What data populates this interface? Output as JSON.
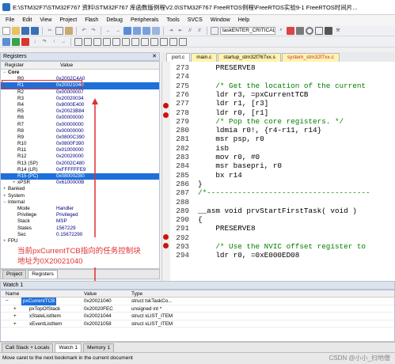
{
  "titlebar": {
    "title": "E:\\STM32F7\\STM32F767 资料\\STM32F767 库函数版例程V2.0\\STM32F767 FreeRTOS例程\\FreeRTOS实验9-1 FreeRTOS时间片..."
  },
  "menu": [
    "File",
    "Edit",
    "View",
    "Project",
    "Flash",
    "Debug",
    "Peripherals",
    "Tools",
    "SVCS",
    "Window",
    "Help"
  ],
  "toolbar": {
    "function_combo": "taskENTER_CRITICAL()"
  },
  "registers": {
    "title": "Registers",
    "col_register": "Register",
    "col_value": "Value",
    "rows": [
      {
        "exp": "−",
        "name": "Core",
        "value": "",
        "indent": 0,
        "bold": true
      },
      {
        "exp": "",
        "name": "R0",
        "value": "0x2002C4A0",
        "indent": 2
      },
      {
        "exp": "",
        "name": "R1",
        "value": "0x20021040",
        "indent": 2,
        "selected": true
      },
      {
        "exp": "",
        "name": "R2",
        "value": "0x00000007",
        "indent": 2
      },
      {
        "exp": "",
        "name": "R3",
        "value": "0x20020034",
        "indent": 2
      },
      {
        "exp": "",
        "name": "R4",
        "value": "0x8000E400",
        "indent": 2
      },
      {
        "exp": "",
        "name": "R5",
        "value": "0x20023B84",
        "indent": 2
      },
      {
        "exp": "",
        "name": "R6",
        "value": "0x00000000",
        "indent": 2
      },
      {
        "exp": "",
        "name": "R7",
        "value": "0x00000000",
        "indent": 2
      },
      {
        "exp": "",
        "name": "R8",
        "value": "0x00000000",
        "indent": 2
      },
      {
        "exp": "",
        "name": "R9",
        "value": "0x0800C390",
        "indent": 2
      },
      {
        "exp": "",
        "name": "R10",
        "value": "0x0800F390",
        "indent": 2
      },
      {
        "exp": "",
        "name": "R11",
        "value": "0x01000000",
        "indent": 2
      },
      {
        "exp": "",
        "name": "R12",
        "value": "0x20020000",
        "indent": 2
      },
      {
        "exp": "",
        "name": "R13 (SP)",
        "value": "0x2002C480",
        "indent": 2
      },
      {
        "exp": "",
        "name": "R14 (LR)",
        "value": "0xFFFFFFE9",
        "indent": 2
      },
      {
        "exp": "",
        "name": "R15 (PC)",
        "value": "0x08000ZB0",
        "indent": 2,
        "selected": true
      },
      {
        "exp": "+",
        "name": "xPSR",
        "value": "0x6100000B",
        "indent": 2
      },
      {
        "exp": "+",
        "name": "Banked",
        "value": "",
        "indent": 0
      },
      {
        "exp": "+",
        "name": "System",
        "value": "",
        "indent": 0
      },
      {
        "exp": "−",
        "name": "Internal",
        "value": "",
        "indent": 0
      },
      {
        "exp": "",
        "name": "Mode",
        "value": "Handler",
        "indent": 2
      },
      {
        "exp": "",
        "name": "Privilege",
        "value": "Privileged",
        "indent": 2
      },
      {
        "exp": "",
        "name": "Stack",
        "value": "MSP",
        "indent": 2
      },
      {
        "exp": "",
        "name": "States",
        "value": "1567229",
        "indent": 2
      },
      {
        "exp": "",
        "name": "Sec",
        "value": "0.15672290",
        "indent": 2
      },
      {
        "exp": "+",
        "name": "FPU",
        "value": "",
        "indent": 0
      }
    ],
    "tabs": [
      "Project",
      "Registers"
    ]
  },
  "annotation": {
    "text": "当前pxCurrentTCB指向的任务控制块地址为0X20021040"
  },
  "editor": {
    "tabs": [
      {
        "label": "port.c",
        "active": true
      },
      {
        "label": "main.c"
      },
      {
        "label": "startup_stm32f767xx.s"
      },
      {
        "label": "system_stm32f7xx.c"
      }
    ],
    "lines": [
      {
        "n": "273",
        "text": "    PRESERVE8",
        "cls": ""
      },
      {
        "n": "274",
        "text": "",
        "cls": ""
      },
      {
        "n": "275",
        "text": "    /* Get the location of the current",
        "cls": "cm"
      },
      {
        "n": "276",
        "text": "    ldr r3, =pxCurrentTCB",
        "cls": ""
      },
      {
        "n": "277",
        "text": "    ldr r1, [r3]",
        "cls": ""
      },
      {
        "n": "278",
        "text": "    ldr r0, [r1]",
        "cls": ""
      },
      {
        "n": "279",
        "text": "    /* Pop the core registers. */",
        "cls": "cm"
      },
      {
        "n": "280",
        "text": "    ldmia r0!, {r4-r11, r14}",
        "cls": ""
      },
      {
        "n": "281",
        "text": "    msr psp, r0",
        "cls": ""
      },
      {
        "n": "282",
        "text": "    isb",
        "cls": ""
      },
      {
        "n": "283",
        "text": "    mov r0, #0",
        "cls": ""
      },
      {
        "n": "284",
        "text": "    msr basepri, r0",
        "cls": ""
      },
      {
        "n": "285",
        "text": "    bx r14",
        "cls": ""
      },
      {
        "n": "286",
        "text": "}",
        "cls": ""
      },
      {
        "n": "287",
        "text": "/*-------------------------------------",
        "cls": "cm"
      },
      {
        "n": "288",
        "text": "",
        "cls": ""
      },
      {
        "n": "289",
        "text": "__asm void prvStartFirstTask( void )",
        "cls": ""
      },
      {
        "n": "290",
        "text": "{",
        "cls": ""
      },
      {
        "n": "291",
        "text": "    PRESERVE8",
        "cls": ""
      },
      {
        "n": "292",
        "text": "",
        "cls": ""
      },
      {
        "n": "293",
        "text": "    /* Use the NVIC offset register to",
        "cls": "cm"
      },
      {
        "n": "294",
        "text": "    ldr r0, =0xE000ED08",
        "cls": ""
      }
    ]
  },
  "watch": {
    "title": "Watch 1",
    "col_name": "Name",
    "col_value": "Value",
    "col_type": "Type",
    "rows": [
      {
        "exp": "−",
        "name": "pxCurrentTCB",
        "value": "0x20021040",
        "type": "struct tskTaskCo...",
        "selected": true
      },
      {
        "exp": "+",
        "name": "pxTopOfStack",
        "value": "0x20020FEC",
        "type": "unsigned int *"
      },
      {
        "exp": "+",
        "name": "xStateListItem",
        "value": "0x20021044",
        "type": "struct xLIST_ITEM"
      },
      {
        "exp": "+",
        "name": "xEventListItem",
        "value": "0x20021058",
        "type": "struct xLIST_ITEM"
      }
    ],
    "tabs": [
      "Call Stack + Locals",
      "Watch 1",
      "Memory 1"
    ]
  },
  "status": {
    "text": "Move caret to the next bookmark in the current document",
    "watermark": "CSDN @小小_扫地僧"
  }
}
